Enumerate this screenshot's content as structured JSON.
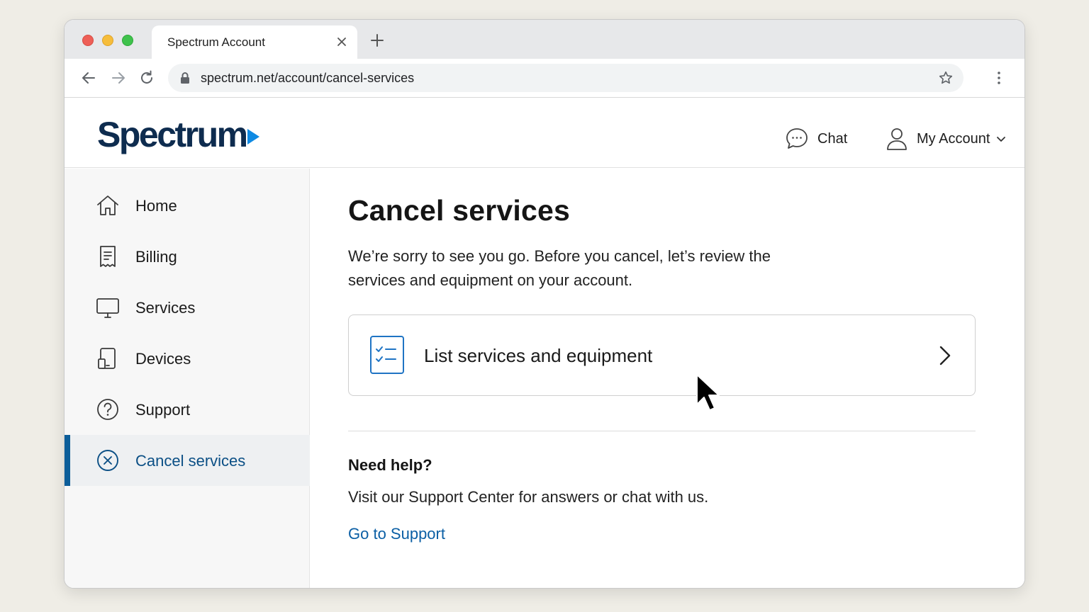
{
  "browser": {
    "tab_title": "Spectrum Account",
    "url": "spectrum.net/account/cancel-services"
  },
  "header": {
    "logo_text": "Spectrum",
    "chat_label": "Chat",
    "account_label": "My Account"
  },
  "sidebar": {
    "items": [
      {
        "label": "Home",
        "icon": "home-icon"
      },
      {
        "label": "Billing",
        "icon": "receipt-icon"
      },
      {
        "label": "Services",
        "icon": "monitor-icon"
      },
      {
        "label": "Devices",
        "icon": "devices-icon"
      },
      {
        "label": "Support",
        "icon": "question-circle-icon"
      },
      {
        "label": "Cancel services",
        "icon": "x-circle-icon",
        "active": true
      }
    ]
  },
  "main": {
    "title": "Cancel services",
    "intro": "We’re sorry to see you go. Before you cancel, let’s review the services and equipment on your account.",
    "card_label": "List services and equipment",
    "help_title": "Need help?",
    "help_text": "Visit our Support Center for answers or chat with us.",
    "help_link": "Go to Support"
  },
  "colors": {
    "brand_navy": "#0e2c4f",
    "brand_blue": "#0f8ae3",
    "active_accent": "#0b5d99",
    "link": "#0b5fa5"
  }
}
